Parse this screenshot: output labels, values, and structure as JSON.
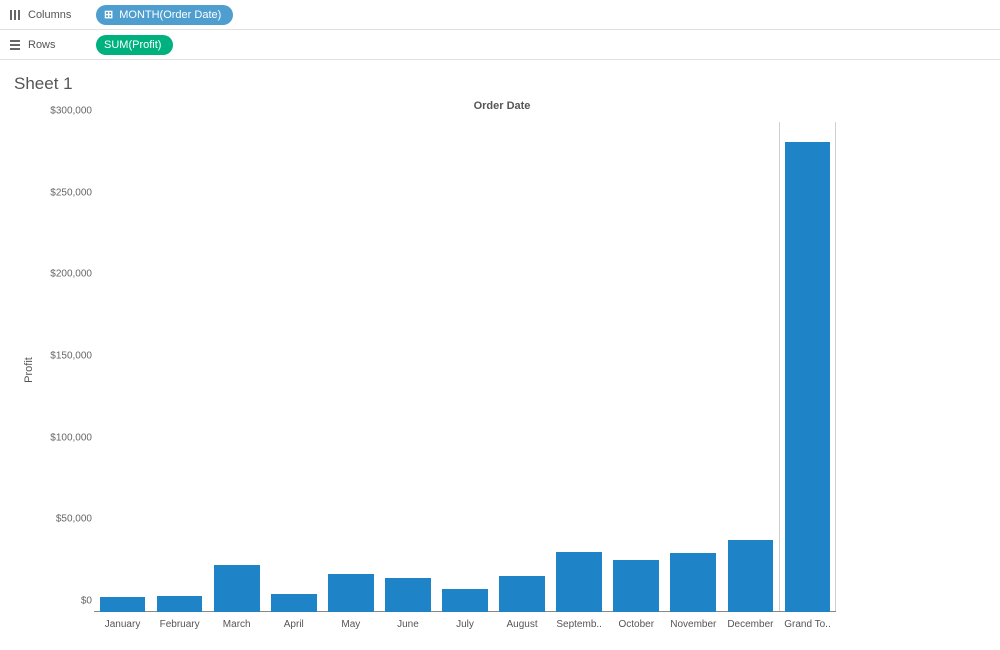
{
  "shelves": {
    "columns_label": "Columns",
    "rows_label": "Rows",
    "columns_pill": "MONTH(Order Date)",
    "rows_pill": "SUM(Profit)"
  },
  "sheet": {
    "title": "Sheet 1"
  },
  "chart_data": {
    "type": "bar",
    "title": "Order Date",
    "ylabel": "Profit",
    "ylim": [
      0,
      300000
    ],
    "y_ticks": [
      "$0",
      "$50,000",
      "$100,000",
      "$150,000",
      "$200,000",
      "$250,000",
      "$300,000"
    ],
    "categories": [
      "January",
      "February",
      "March",
      "April",
      "May",
      "June",
      "July",
      "August",
      "Septemb..",
      "October",
      "November",
      "December",
      "Grand To.."
    ],
    "values": [
      9000,
      10000,
      29000,
      11000,
      23000,
      21000,
      14000,
      22000,
      37000,
      32000,
      36000,
      44000,
      288000
    ]
  }
}
